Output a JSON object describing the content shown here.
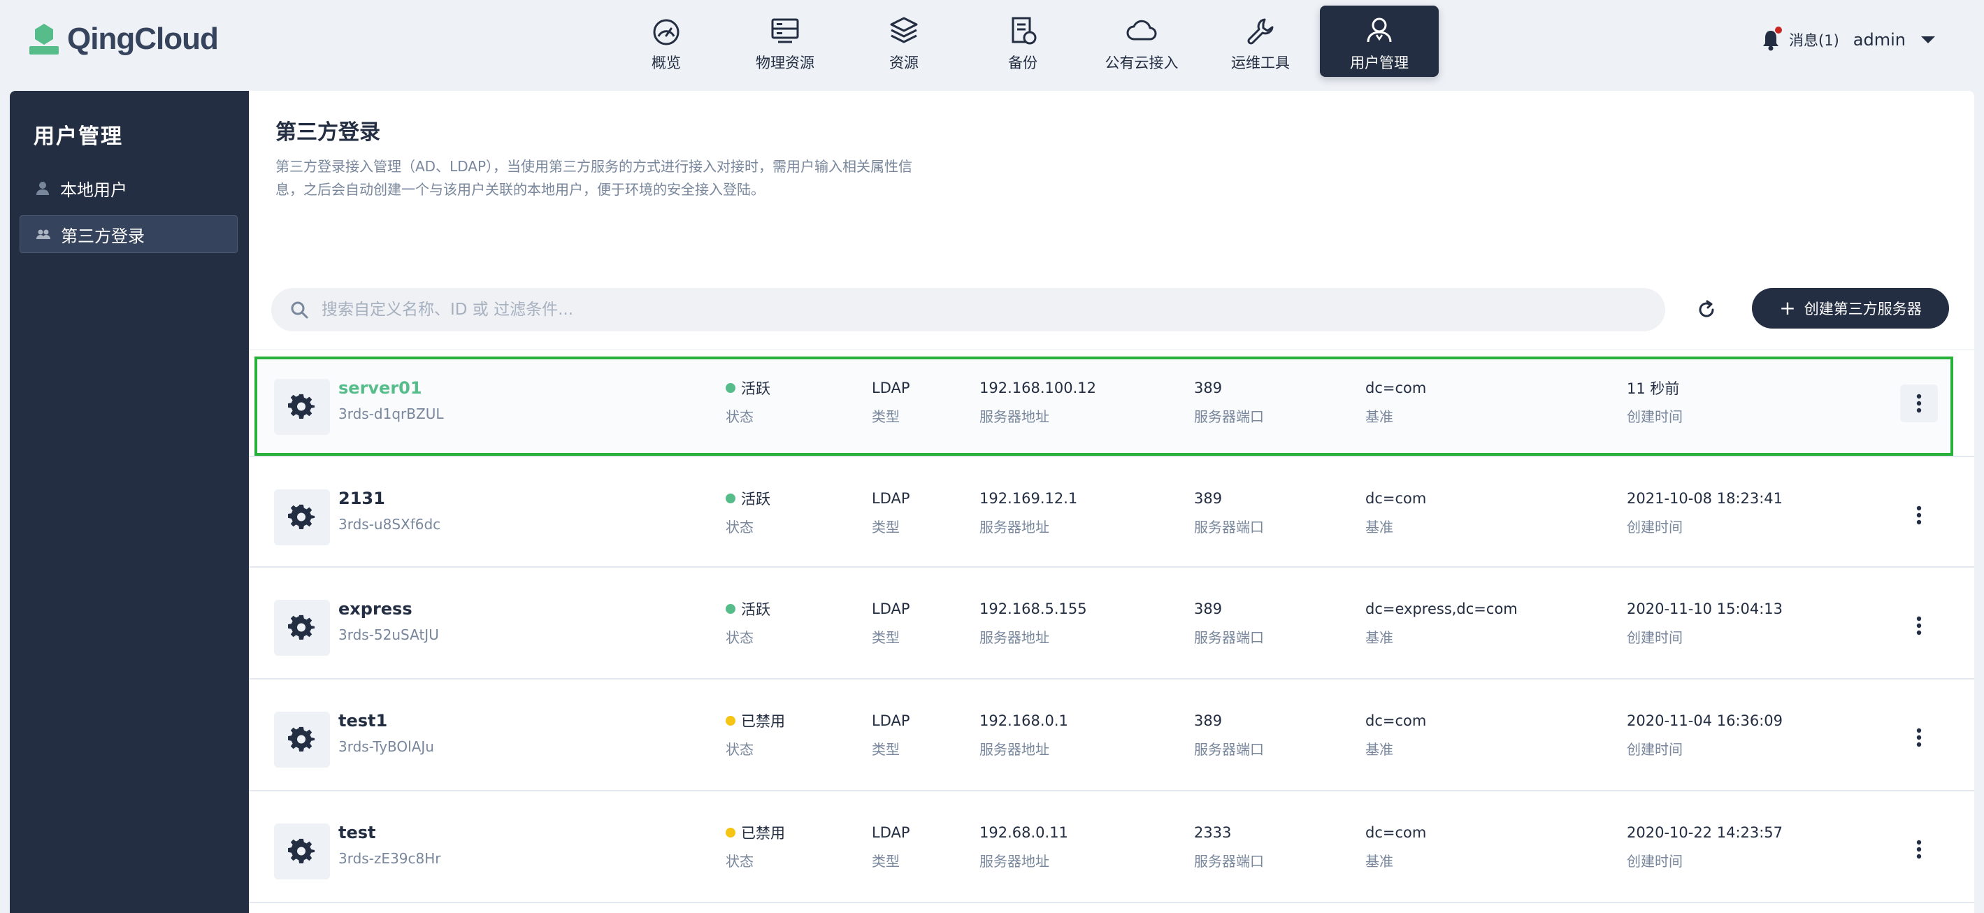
{
  "brand": {
    "name": "QingCloud",
    "color": "#55bc8a"
  },
  "nav": [
    {
      "label": "概览",
      "icon": "dashboard-icon",
      "active": false
    },
    {
      "label": "物理资源",
      "icon": "server-icon",
      "active": false
    },
    {
      "label": "资源",
      "icon": "layers-icon",
      "active": false
    },
    {
      "label": "备份",
      "icon": "backup-icon",
      "active": false
    },
    {
      "label": "公有云接入",
      "icon": "cloud-icon",
      "active": false
    },
    {
      "label": "运维工具",
      "icon": "wrench-icon",
      "active": false
    },
    {
      "label": "用户管理",
      "icon": "user-manage-icon",
      "active": true
    }
  ],
  "topright": {
    "messages": "消息(1)",
    "user": "admin"
  },
  "sidebar": {
    "title": "用户管理",
    "items": [
      {
        "label": "本地用户",
        "icon": "user-icon",
        "active": false
      },
      {
        "label": "第三方登录",
        "icon": "users-icon",
        "active": true
      }
    ]
  },
  "page": {
    "title": "第三方登录",
    "description": "第三方登录接入管理（AD、LDAP），当使用第三方服务的方式进行接入对接时，需用户输入相关属性信息，之后会自动创建一个与该用户关联的本地用户，便于环境的安全接入登陆。"
  },
  "toolbar": {
    "search_placeholder": "搜索自定义名称、ID 或 过滤条件...",
    "create_label": "创建第三方服务器",
    "create_plus": "+"
  },
  "columns": {
    "status": "状态",
    "type": "类型",
    "address": "服务器地址",
    "port": "服务器端口",
    "base": "基准",
    "created": "创建时间"
  },
  "colors": {
    "active": "#55bc8a",
    "disabled": "#f5c414",
    "selected_outline": "#27b13b"
  },
  "rows": [
    {
      "name": "server01",
      "id": "3rds-d1qrBZUL",
      "status": "活跃",
      "status_color": "#55bc8a",
      "type": "LDAP",
      "address": "192.168.100.12",
      "port": "389",
      "base": "dc=com",
      "created": "11 秒前",
      "selected": true
    },
    {
      "name": "2131",
      "id": "3rds-u8SXf6dc",
      "status": "活跃",
      "status_color": "#55bc8a",
      "type": "LDAP",
      "address": "192.169.12.1",
      "port": "389",
      "base": "dc=com",
      "created": "2021-10-08 18:23:41",
      "selected": false
    },
    {
      "name": "express",
      "id": "3rds-52uSAtJU",
      "status": "活跃",
      "status_color": "#55bc8a",
      "type": "LDAP",
      "address": "192.168.5.155",
      "port": "389",
      "base": "dc=express,dc=com",
      "created": "2020-11-10 15:04:13",
      "selected": false
    },
    {
      "name": "test1",
      "id": "3rds-TyBOlAJu",
      "status": "已禁用",
      "status_color": "#f5c414",
      "type": "LDAP",
      "address": "192.168.0.1",
      "port": "389",
      "base": "dc=com",
      "created": "2020-11-04 16:36:09",
      "selected": false
    },
    {
      "name": "test",
      "id": "3rds-zE39c8Hr",
      "status": "已禁用",
      "status_color": "#f5c414",
      "type": "LDAP",
      "address": "192.68.0.11",
      "port": "2333",
      "base": "dc=com",
      "created": "2020-10-22 14:23:57",
      "selected": false
    }
  ]
}
